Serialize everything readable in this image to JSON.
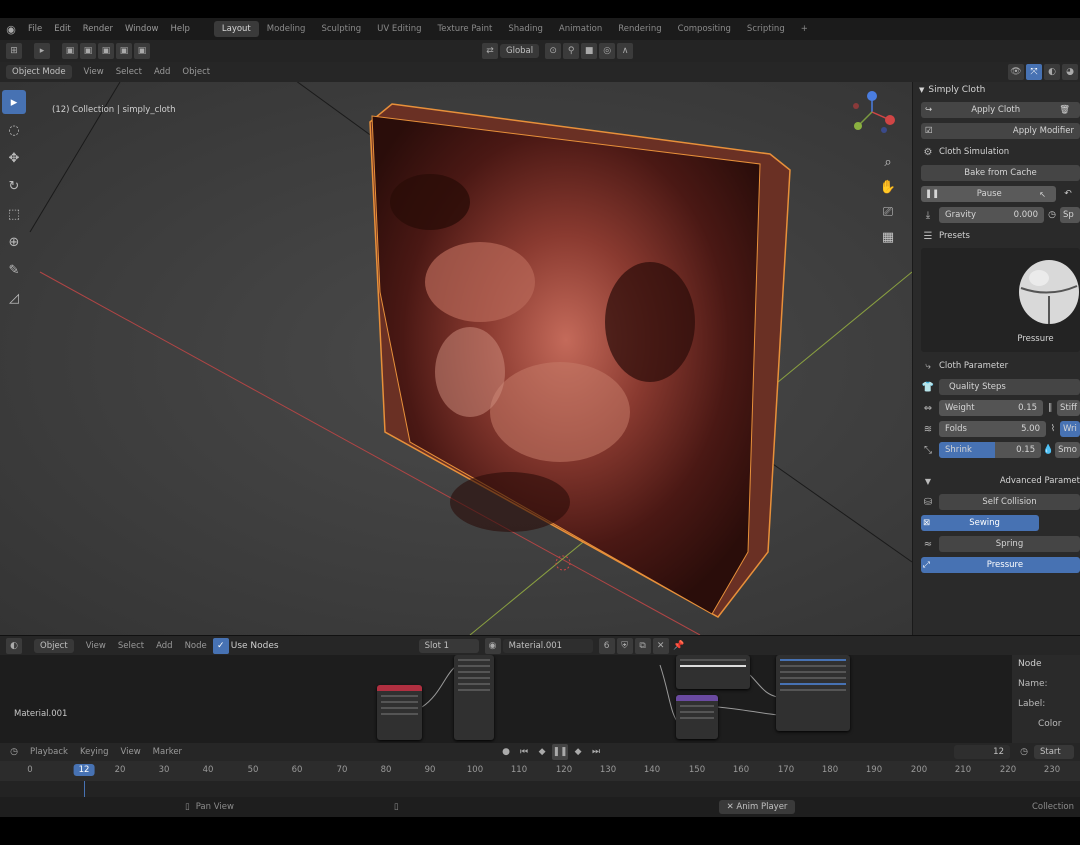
{
  "menu": {
    "items": [
      "File",
      "Edit",
      "Render",
      "Window",
      "Help"
    ]
  },
  "workspaces": [
    "Layout",
    "Modeling",
    "Sculpting",
    "UV Editing",
    "Texture Paint",
    "Shading",
    "Animation",
    "Rendering",
    "Compositing",
    "Scripting",
    "+"
  ],
  "toolbar": {
    "orientation": "Global"
  },
  "viewport_header": {
    "mode": "Object Mode",
    "view": "View",
    "select": "Select",
    "add": "Add",
    "object": "Object"
  },
  "viewport": {
    "collection_label": "(12) Collection | simply_cloth"
  },
  "npanel": {
    "title": "Simply Cloth",
    "apply_cloth": "Apply Cloth",
    "apply_modifier": "Apply Modifier",
    "cloth_simulation": "Cloth Simulation",
    "bake_from_cache": "Bake from Cache",
    "pause": "Pause",
    "gravity_label": "Gravity",
    "gravity_value": "0.000",
    "speed_label": "Sp",
    "presets": "Presets",
    "preset_name": "Pressure",
    "cloth_parameter": "Cloth Parameter",
    "quality_steps": "Quality Steps",
    "weight_label": "Weight",
    "weight_value": "0.15",
    "stiff_label": "Stiff",
    "folds_label": "Folds",
    "folds_value": "5.00",
    "wrin_label": "Wri",
    "shrink_label": "Shrink",
    "shrink_value": "0.15",
    "shrink_fill": 0.55,
    "smo_label": "Smo",
    "advanced_parameter": "Advanced Paramet",
    "self_collision": "Self Collision",
    "sewing": "Sewing",
    "spring": "Spring",
    "pressure": "Pressure"
  },
  "node_header": {
    "editor": "Object",
    "view": "View",
    "select": "Select",
    "add": "Add",
    "node": "Node",
    "use_nodes": "Use Nodes",
    "slot": "Slot 1",
    "material": "Material.001",
    "users": "6"
  },
  "node_editor": {
    "material_label": "Material.001"
  },
  "node_side": {
    "title": "Node",
    "name_label": "Name:",
    "label_label": "Label:",
    "color_label": "Color"
  },
  "timeline": {
    "playback": "Playback",
    "keying": "Keying",
    "view": "View",
    "marker": "Marker",
    "current_frame": "12",
    "start_label": "Start",
    "ticks": [
      "0",
      "12",
      "20",
      "30",
      "40",
      "50",
      "60",
      "70",
      "80",
      "90",
      "100",
      "110",
      "120",
      "130",
      "140",
      "150",
      "160",
      "170",
      "180",
      "190",
      "200",
      "210",
      "220",
      "230"
    ]
  },
  "statusbar": {
    "pan_view": "Pan View",
    "anim_player": "Anim Player",
    "collection": "Collection"
  },
  "colors": {
    "accent": "#4772b3",
    "selection_outline": "#e8903a",
    "x_axis": "#c44a4a",
    "y_axis": "#8aa040"
  }
}
